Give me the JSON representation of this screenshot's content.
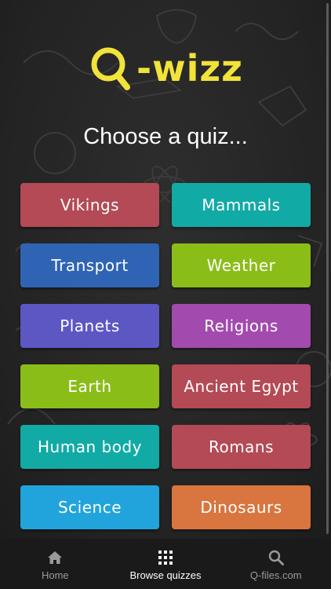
{
  "app": {
    "logo_text": "-wizz",
    "logo_color": "#f1e33a"
  },
  "header": {
    "title": "Choose a quiz..."
  },
  "quizzes": [
    {
      "label": "Vikings",
      "color": "#b34a55",
      "icon": "none"
    },
    {
      "label": "Mammals",
      "color": "#12aaa5",
      "icon": "none"
    },
    {
      "label": "Transport",
      "color": "#2f64b5",
      "icon": "none"
    },
    {
      "label": "Weather",
      "color": "#8bbd19",
      "icon": "none"
    },
    {
      "label": "Planets",
      "color": "#5d57c4",
      "icon": "none"
    },
    {
      "label": "Religions",
      "color": "#a24aae",
      "icon": "none"
    },
    {
      "label": "Earth",
      "color": "#8bbd19",
      "icon": "none"
    },
    {
      "label": "Ancient Egypt",
      "color": "#b34a55",
      "icon": "none"
    },
    {
      "label": "Human body",
      "color": "#12aaa5",
      "icon": "none"
    },
    {
      "label": "Romans",
      "color": "#b34a55",
      "icon": "none"
    },
    {
      "label": "Science",
      "color": "#21a4dc",
      "icon": "none"
    },
    {
      "label": "Dinosaurs",
      "color": "#d9753e",
      "icon": "none"
    }
  ],
  "navbar": {
    "items": [
      {
        "label": "Home",
        "icon": "home-icon",
        "active": false
      },
      {
        "label": "Browse quizzes",
        "icon": "grid-icon",
        "active": true
      },
      {
        "label": "Q-files.com",
        "icon": "search-icon",
        "active": false
      }
    ],
    "active_color": "#ffffff",
    "inactive_color": "#9a9a9a"
  }
}
